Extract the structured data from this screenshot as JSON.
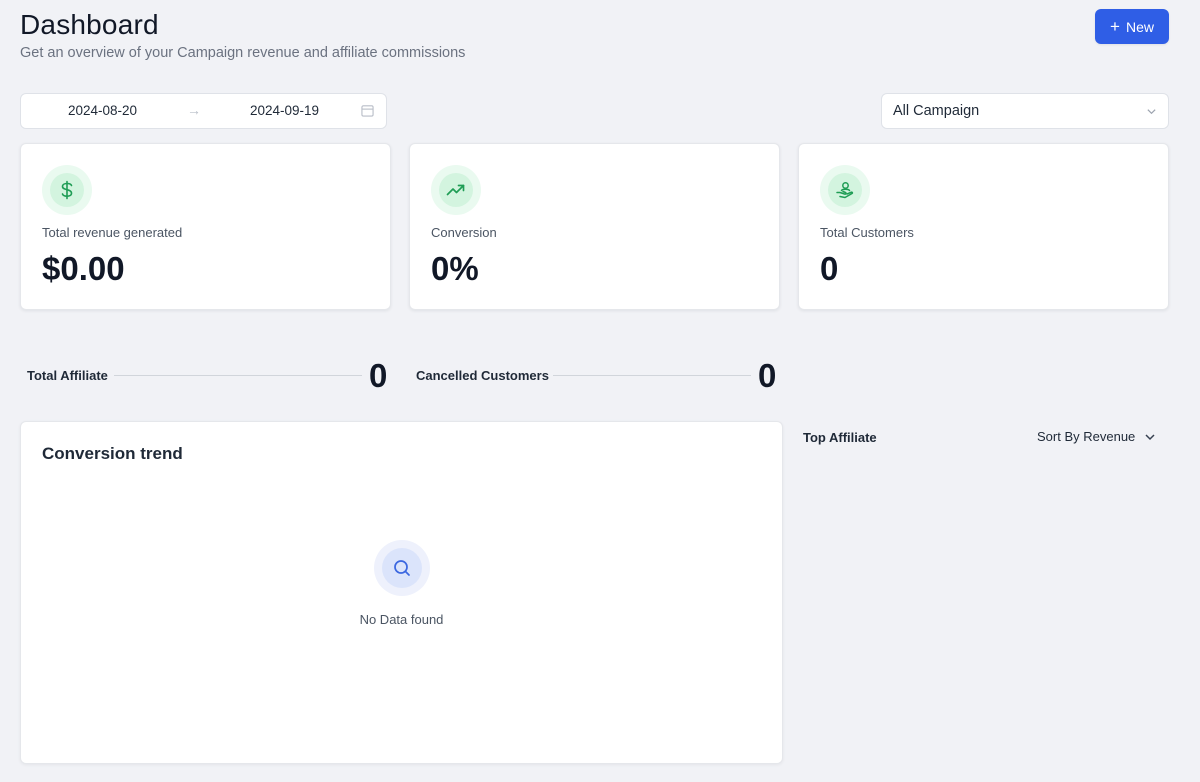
{
  "header": {
    "title": "Dashboard",
    "subtitle": "Get an overview of your Campaign revenue and affiliate commissions",
    "new_button_label": "New"
  },
  "filters": {
    "date_start": "2024-08-20",
    "date_end": "2024-09-19",
    "campaign_selected": "All Campaign"
  },
  "stat_cards": [
    {
      "icon": "dollar-icon",
      "label": "Total revenue generated",
      "value": "$0.00"
    },
    {
      "icon": "trending-up-icon",
      "label": "Conversion",
      "value": "0%"
    },
    {
      "icon": "customers-icon",
      "label": "Total Customers",
      "value": "0"
    }
  ],
  "summary": {
    "total_affiliate_label": "Total Affiliate",
    "total_affiliate_value": "0",
    "cancelled_customers_label": "Cancelled Customers",
    "cancelled_customers_value": "0"
  },
  "conversion_trend": {
    "title": "Conversion trend",
    "empty_text": "No Data found"
  },
  "top_affiliate": {
    "title": "Top Affiliate",
    "sort_label": "Sort By Revenue"
  },
  "colors": {
    "primary": "#2f5ee6",
    "background": "#f1f2f6",
    "success": "#1f9d55"
  }
}
